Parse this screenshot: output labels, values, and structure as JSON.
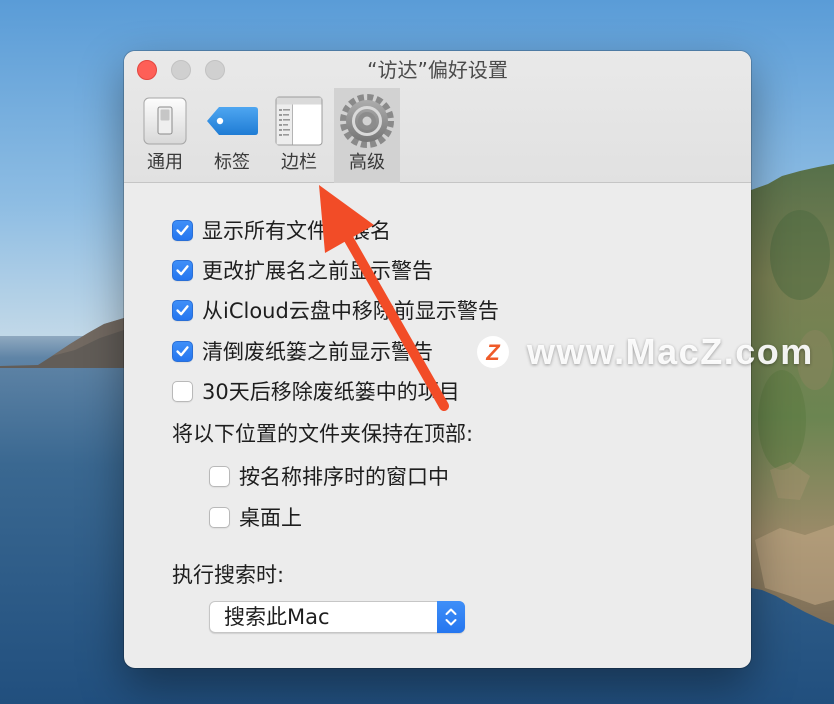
{
  "window": {
    "title": "“访达”偏好设置",
    "close_color": "#fe5f57",
    "inactive_light_color": "#d0d0d0"
  },
  "toolbar": {
    "tabs": [
      {
        "label": "通用",
        "icon": "light-switch-icon",
        "selected": false
      },
      {
        "label": "标签",
        "icon": "tag-icon",
        "selected": false
      },
      {
        "label": "边栏",
        "icon": "sidebar-icon",
        "selected": false
      },
      {
        "label": "高级",
        "icon": "gear-icon",
        "selected": true
      }
    ]
  },
  "options": [
    {
      "label": "显示所有文件扩展名",
      "checked": true
    },
    {
      "label": "更改扩展名之前显示警告",
      "checked": true
    },
    {
      "label": "从iCloud云盘中移除前显示警告",
      "checked": true
    },
    {
      "label": "清倒废纸篓之前显示警告",
      "checked": true
    },
    {
      "label": "30天后移除废纸篓中的项目",
      "checked": false
    }
  ],
  "keep_folders_on_top": {
    "label": "将以下位置的文件夹保持在顶部:",
    "options": [
      {
        "label": "按名称排序时的窗口中",
        "checked": false
      },
      {
        "label": "桌面上",
        "checked": false
      }
    ]
  },
  "search": {
    "label": "执行搜索时:",
    "selected": "搜索此Mac"
  },
  "watermark": {
    "text": "www.MacZ.com",
    "logo_letter": "Z"
  },
  "colors": {
    "accent": "#2b7ff6",
    "annotation_arrow": "#f24c27"
  }
}
